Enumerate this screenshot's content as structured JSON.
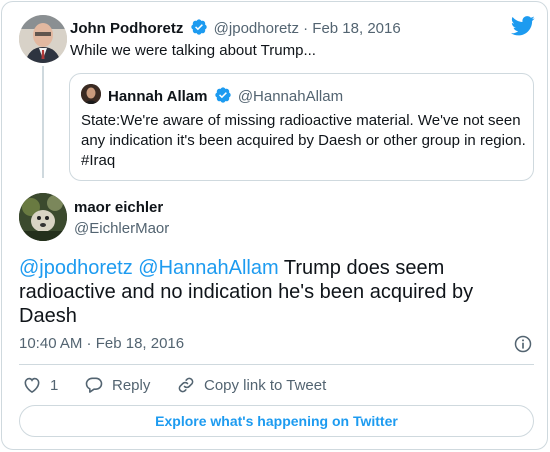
{
  "parent_tweet": {
    "name": "John Podhoretz",
    "handle": "@jpodhoretz",
    "separator": "·",
    "date": "Feb 18, 2016",
    "text": "While we were talking about Trump..."
  },
  "quoted_tweet": {
    "name": "Hannah Allam",
    "handle": "@HannahAllam",
    "text": "State:We're aware of missing radioactive material. We've not seen any indication it's been acquired by Daesh or other group in region. #Iraq"
  },
  "main_tweet": {
    "name": "maor eichler",
    "handle": "@EichlerMaor",
    "mention_1": "@jpodhoretz",
    "mention_2": "@HannahAllam",
    "text": "Trump does seem radioactive and no indication he's been acquired by Daesh",
    "timestamp": "10:40 AM · Feb 18, 2016"
  },
  "actions": {
    "like_count": "1",
    "reply_label": "Reply",
    "copy_link_label": "Copy link to Tweet"
  },
  "explore_button": "Explore what's happening on Twitter",
  "colors": {
    "accent": "#1d9bf0",
    "like_red": "#f91880",
    "text_primary": "#0f1419",
    "text_secondary": "#536471",
    "border": "#cfd9de"
  }
}
